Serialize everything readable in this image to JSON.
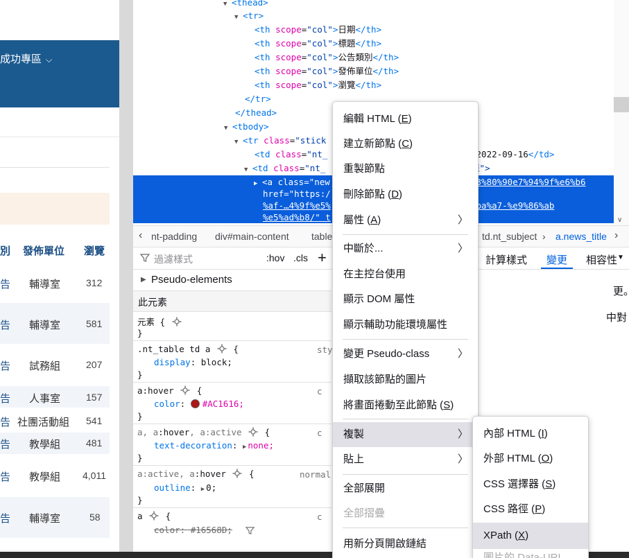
{
  "page": {
    "banner_text": "成功專區",
    "table_headers": [
      "別",
      "發佈單位",
      "瀏覽"
    ],
    "rows": [
      {
        "c1": "告",
        "unit": "輔導室",
        "views": "312"
      },
      {
        "c1": "告",
        "unit": "輔導室",
        "views": "581"
      },
      {
        "c1": "告",
        "unit": "試務組",
        "views": "207"
      },
      {
        "c1": "告",
        "unit": "人事室",
        "views": "157"
      },
      {
        "c1": "告",
        "unit": "社團活動組",
        "views": "541"
      },
      {
        "c1": "告",
        "unit": "教學組",
        "views": "481"
      },
      {
        "c1": "告",
        "unit": "教學組",
        "views": "4,011"
      },
      {
        "c1": "告",
        "unit": "輔導室",
        "views": "58"
      }
    ]
  },
  "inspector": {
    "lines": {
      "thead_open": "<thead>",
      "tr_open": "<tr>",
      "th1_text": "日期",
      "th2_text": "標題",
      "th3_text": "公告類別",
      "th4_text": "發佈單位",
      "th5_text": "瀏覽",
      "th_scope_attr": "scope",
      "th_scope_val": "\"col\"",
      "tr_close": "</tr>",
      "thead_close": "</thead>",
      "tbody_open": "<tbody>",
      "tr_class_partial": "\"stick",
      "td1_class_partial": "\"nt_",
      "td1_date_partial": "-2022-09-16",
      "td2_class_partial": "\"nt_",
      "td2_end_partial": "題\">",
      "sel_line1": "<a class=\"new",
      "sel_line1_right": "e3%80%90e7%94%9f%e6%b6",
      "sel_line2_left": "href=\"https:/",
      "sel_line3_left": "%af-…4%9f%e5%",
      "sel_line3_right": "%ba%a7-%e9%86%ab",
      "sel_line4_left": "%e5%ad%b8/\" t"
    },
    "breadcrumbs": [
      "nt-padding",
      "div#main-content",
      "table",
      "td.nt_subject",
      "a.news_title"
    ],
    "filter_placeholder": "過濾樣式",
    "hov_label": ":hov",
    "cls_label": ".cls",
    "plus_label": "+",
    "pseudo_elements_label": "Pseudo-elements",
    "this_element_label": "此元素",
    "rules": {
      "r1_selector": "元素 {",
      "r1_close": "}",
      "r2_selector": ".nt_table td a",
      "r2_src": "sty",
      "r2_prop": "display",
      "r2_val": "block;",
      "r3_selector": "a:hover",
      "r3_src": "c",
      "r3_prop": "color",
      "r3_val": "#AC1616;",
      "r4_selector_a": "a, a",
      "r4_selector_hover": ":hover",
      "r4_selector_c": ", a:active",
      "r4_src": "c",
      "r4_prop": "text-decoration",
      "r4_val": "none;",
      "r5_selector_a": "a:active, a",
      "r5_selector_hover": ":hover",
      "r5_src": "normal",
      "r5_prop": "outline",
      "r5_val": "0;",
      "r6_selector": "a",
      "r6_src": "c",
      "r6_prop": "color",
      "r6_val": "#16568D;"
    },
    "side_tabs": {
      "computed": "計算樣式",
      "changes": "變更",
      "compat": "相容性"
    },
    "side_text_1": "更。",
    "side_text_2": "中對 CSS 的修改將顯示於此"
  },
  "context_menu": {
    "items": [
      {
        "label": "編輯 HTML",
        "key": "E"
      },
      {
        "label": "建立新節點",
        "key": "C"
      },
      {
        "label": "重製節點",
        "key": ""
      },
      {
        "label": "刪除節點",
        "key": "D"
      },
      {
        "label": "屬性",
        "key": "A"
      },
      {
        "label": "中斷於...",
        "key": ""
      },
      {
        "label": "在主控台使用",
        "key": ""
      },
      {
        "label": "顯示 DOM 屬性",
        "key": ""
      },
      {
        "label": "顯示輔助功能環境屬性",
        "key": ""
      },
      {
        "label": "變更 Pseudo-class",
        "key": ""
      },
      {
        "label": "擷取該節點的圖片",
        "key": ""
      },
      {
        "label": "將畫面捲動至此節點",
        "key": "S"
      },
      {
        "label": "複製",
        "key": ""
      },
      {
        "label": "貼上",
        "key": ""
      },
      {
        "label": "全部展開",
        "key": ""
      },
      {
        "label": "全部摺疊",
        "key": ""
      },
      {
        "label": "用新分頁開啟鏈結",
        "key": ""
      }
    ]
  },
  "copy_submenu": {
    "items": [
      {
        "label": "內部 HTML",
        "key": "I"
      },
      {
        "label": "外部 HTML",
        "key": "O"
      },
      {
        "label": "CSS 選擇器",
        "key": "S"
      },
      {
        "label": "CSS 路徑",
        "key": "P"
      },
      {
        "label": "XPath",
        "key": "X"
      },
      {
        "label": "圖片的 Data-URL",
        "key": ""
      }
    ]
  },
  "colors": {
    "banner": "#1b5a8f",
    "selection": "#0a5edb",
    "hover_color_swatch": "#AC1616",
    "accent": "#0060df"
  }
}
